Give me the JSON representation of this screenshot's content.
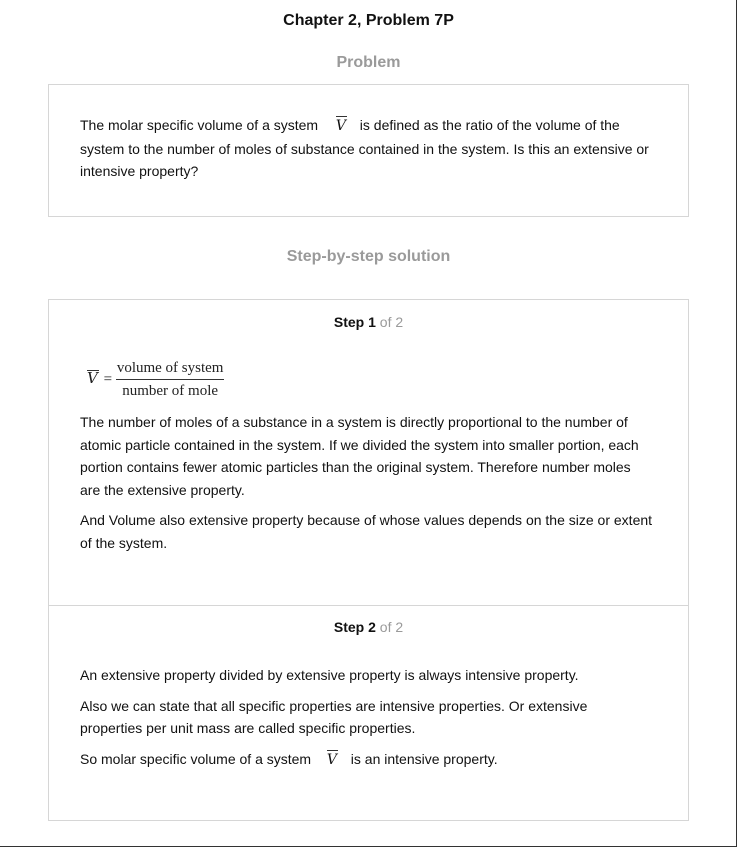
{
  "header": {
    "title": "Chapter 2, Problem 7P"
  },
  "problem": {
    "heading": "Problem",
    "text_before": "The molar specific volume of a system",
    "symbol": "V",
    "text_after": "is defined as the ratio of the volume of the",
    "line2": "system to the number of moles of substance contained in the system. Is this an extensive or",
    "line3": "intensive property?"
  },
  "solution": {
    "heading": "Step-by-step solution",
    "steps": [
      {
        "label": "Step",
        "number": "1",
        "of_total": "of 2",
        "formula": {
          "lhs": "V",
          "eq": "=",
          "numerator": "volume of system",
          "denominator": "number of mole"
        },
        "paragraphs": [
          [
            "The number of moles of a substance in a system is directly proportional to the number of",
            "atomic particle contained in the system. If we divided the system into smaller portion, each",
            "portion contains fewer atomic particles than the original system. Therefore number moles",
            "are the extensive property."
          ],
          [
            "And Volume also extensive property because of whose values depends on the size or extent",
            "of the system."
          ]
        ]
      },
      {
        "label": "Step",
        "number": "2",
        "of_total": "of 2",
        "paragraphs": [
          [
            "An extensive property divided by extensive property is always intensive property."
          ],
          [
            "Also we can state that all specific properties are intensive properties. Or extensive",
            "properties per unit mass are called specific properties."
          ]
        ],
        "last_before": "So molar specific volume of a system",
        "last_symbol": "V",
        "last_after": "is an intensive property."
      }
    ]
  }
}
